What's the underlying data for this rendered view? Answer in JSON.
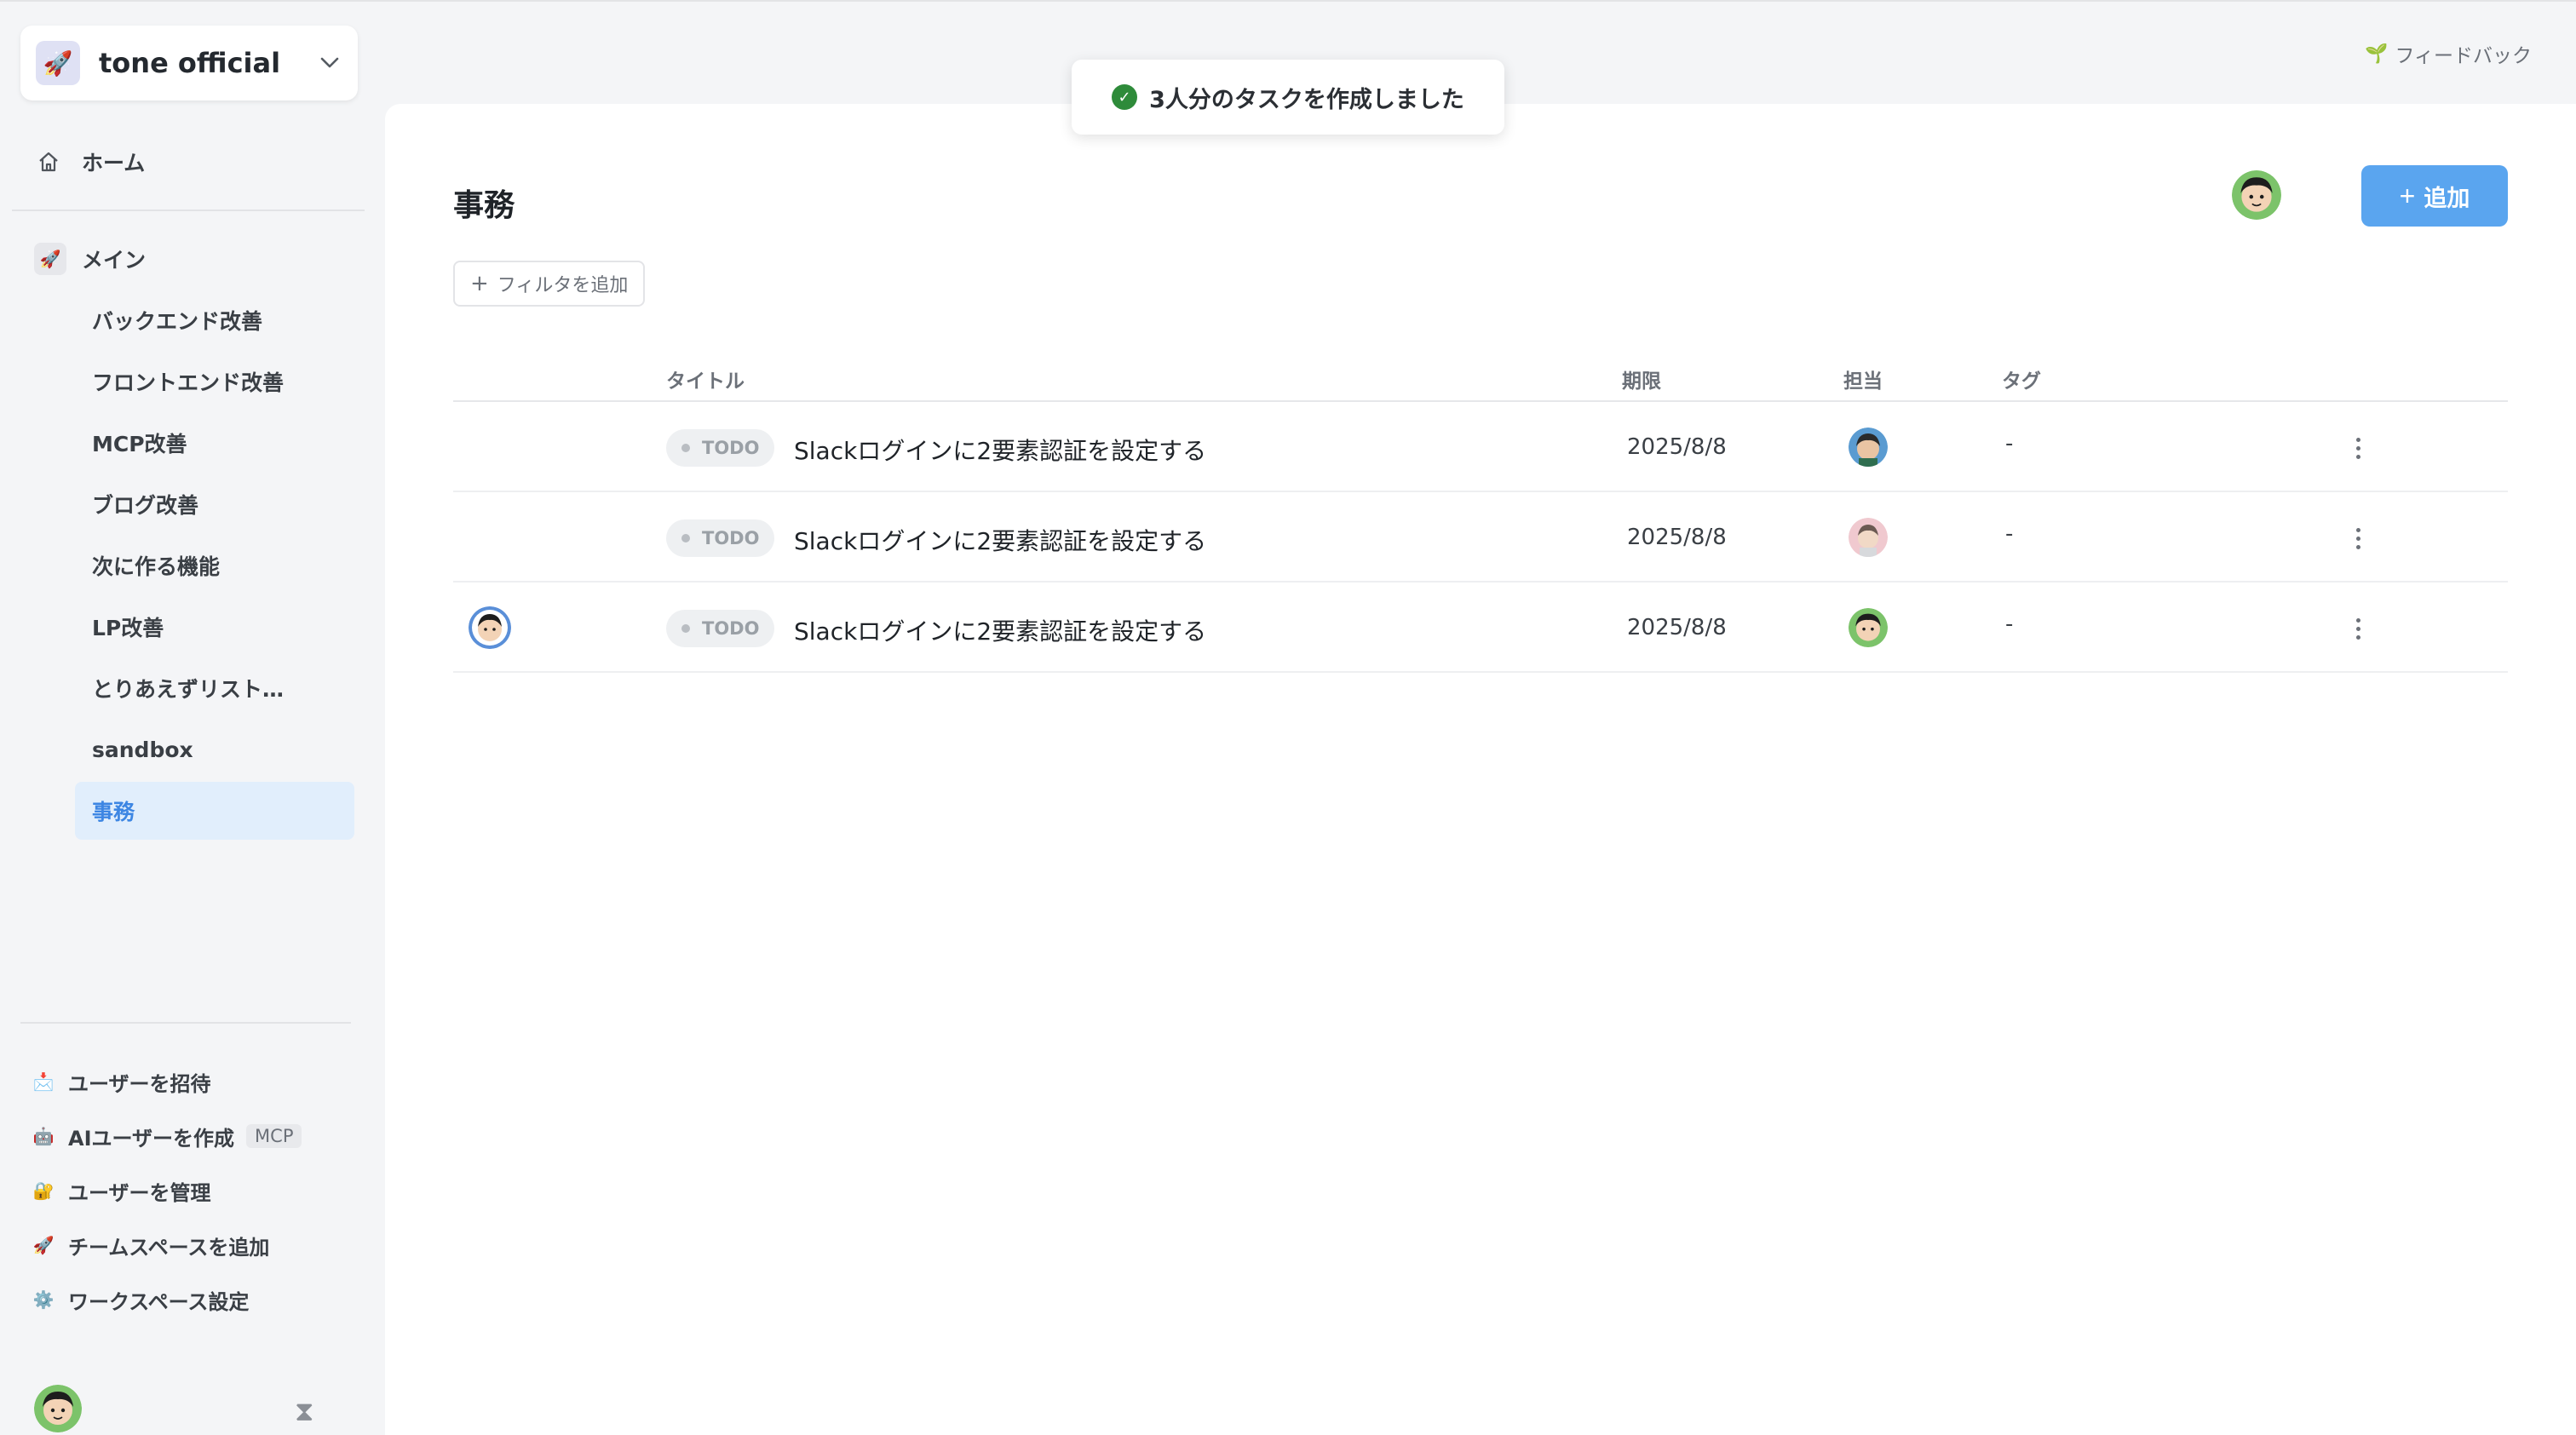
{
  "workspace": {
    "name": "tone official",
    "icon": "rocket-icon"
  },
  "sidebar": {
    "home_label": "ホーム",
    "main_label": "メイン",
    "items": [
      {
        "label": "バックエンド改善",
        "active": false
      },
      {
        "label": "フロントエンド改善",
        "active": false
      },
      {
        "label": "MCP改善",
        "active": false
      },
      {
        "label": "ブログ改善",
        "active": false
      },
      {
        "label": "次に作る機能",
        "active": false
      },
      {
        "label": "LP改善",
        "active": false
      },
      {
        "label": "とりあえずリスト…",
        "active": false
      },
      {
        "label": "sandbox",
        "active": false
      },
      {
        "label": "事務",
        "active": true
      }
    ],
    "bottom": [
      {
        "label": "ユーザーを招待",
        "icon": "mail-icon"
      },
      {
        "label": "AIユーザーを作成",
        "icon": "robot-icon",
        "badge": "MCP"
      },
      {
        "label": "ユーザーを管理",
        "icon": "lock-icon"
      },
      {
        "label": "チームスペースを追加",
        "icon": "rocket-icon"
      },
      {
        "label": "ワークスペース設定",
        "icon": "gear-icon"
      }
    ]
  },
  "header": {
    "feedback_label": "フィードバック",
    "page_title": "事務",
    "add_label": "追加",
    "filter_label": "フィルタを追加"
  },
  "toast": {
    "message": "3人分のタスクを作成しました"
  },
  "table": {
    "columns": {
      "title": "タイトル",
      "due": "期限",
      "assignee": "担当",
      "tag": "タグ"
    },
    "rows": [
      {
        "status": "TODO",
        "title": "Slackログインに2要素認証を設定する",
        "due": "2025/8/8",
        "tag": "-"
      },
      {
        "status": "TODO",
        "title": "Slackログインに2要素認証を設定する",
        "due": "2025/8/8",
        "tag": "-"
      },
      {
        "status": "TODO",
        "title": "Slackログインに2要素認証を設定する",
        "due": "2025/8/8",
        "tag": "-"
      }
    ]
  },
  "colors": {
    "accent": "#5aa5ef",
    "active_bg": "#e1eefc",
    "active_text": "#3d86e3",
    "toast_check": "#2e8b3a"
  }
}
